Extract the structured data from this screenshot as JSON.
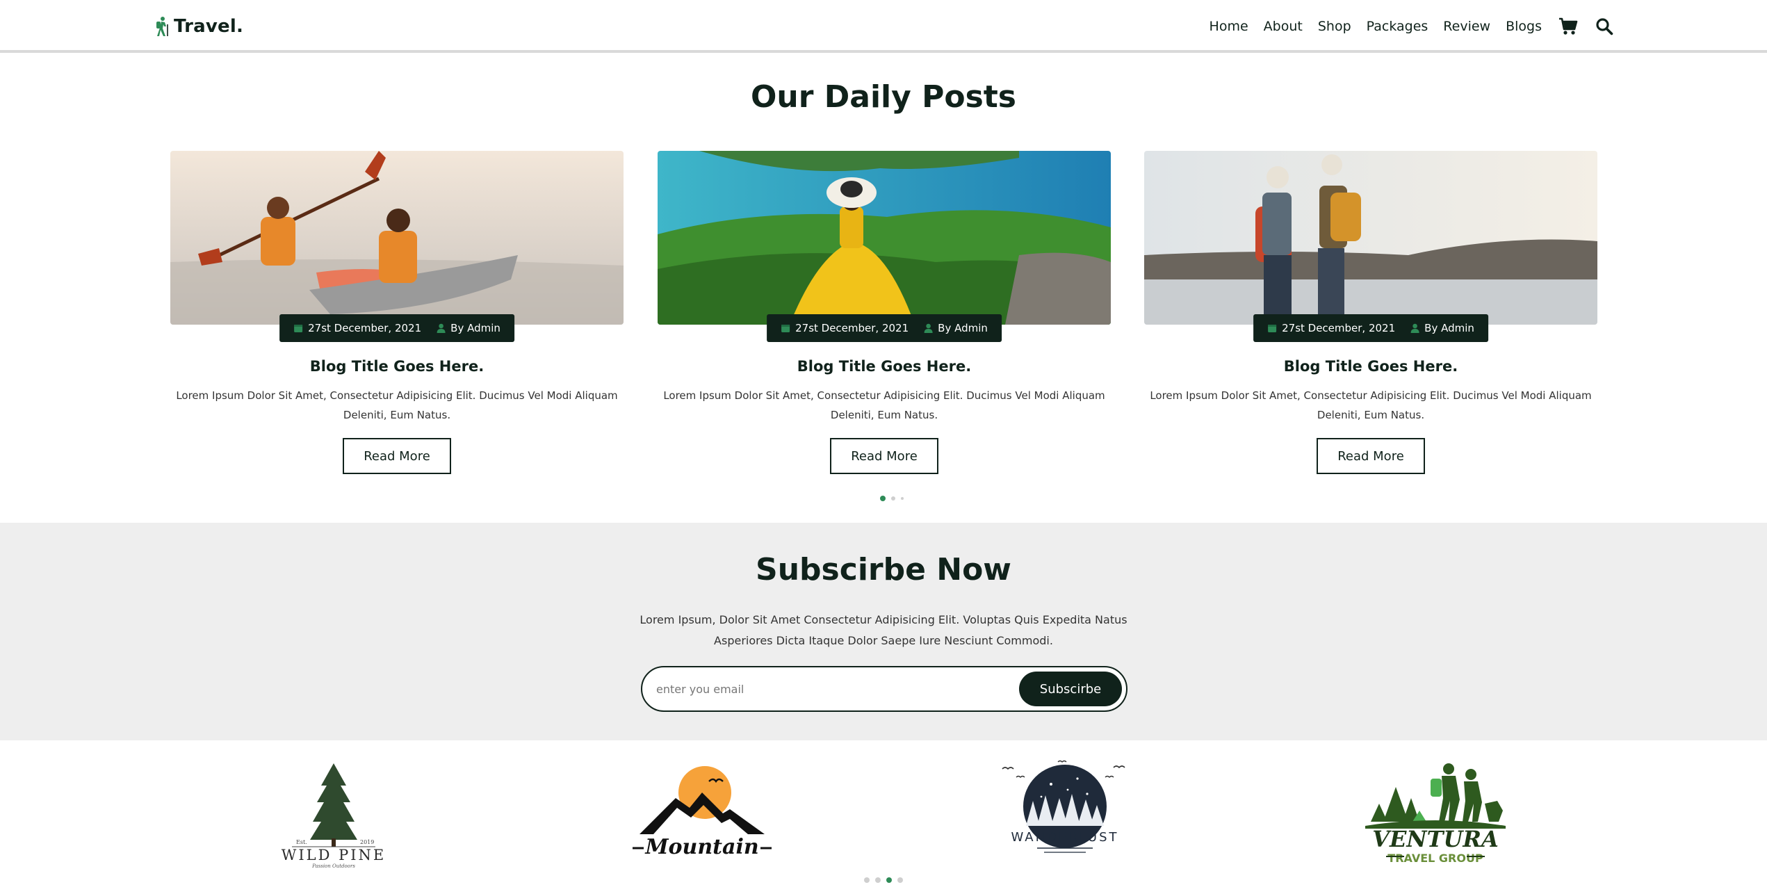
{
  "header": {
    "logo_text": "Travel.",
    "nav": [
      "Home",
      "About",
      "Shop",
      "Packages",
      "Review",
      "Blogs"
    ]
  },
  "posts": {
    "title": "Our Daily Posts",
    "cards": [
      {
        "date": "27st December, 2021",
        "author": "By Admin",
        "title": "Blog Title Goes Here.",
        "text": "Lorem Ipsum Dolor Sit Amet, Consectetur Adipisicing Elit. Ducimus Vel Modi Aliquam Deleniti, Eum Natus.",
        "button": "Read More"
      },
      {
        "date": "27st December, 2021",
        "author": "By Admin",
        "title": "Blog Title Goes Here.",
        "text": "Lorem Ipsum Dolor Sit Amet, Consectetur Adipisicing Elit. Ducimus Vel Modi Aliquam Deleniti, Eum Natus.",
        "button": "Read More"
      },
      {
        "date": "27st December, 2021",
        "author": "By Admin",
        "title": "Blog Title Goes Here.",
        "text": "Lorem Ipsum Dolor Sit Amet, Consectetur Adipisicing Elit. Ducimus Vel Modi Aliquam Deleniti, Eum Natus.",
        "button": "Read More"
      }
    ],
    "pagination_active": 1,
    "pagination_count": 3
  },
  "subscribe": {
    "title": "Subscirbe Now",
    "text_line1": "Lorem Ipsum, Dolor Sit Amet Consectetur Adipisicing Elit. Voluptas Quis Expedita Natus",
    "text_line2": "Asperiores Dicta Itaque Dolor Saepe Iure Nesciunt Commodi.",
    "placeholder": "enter you email",
    "button": "Subscirbe"
  },
  "brands": {
    "wild_pine": {
      "name": "WILD PINE",
      "est": "Est.",
      "year": "2019",
      "tagline": "Passion Outdoors"
    },
    "mountain": {
      "name": "Mountain"
    },
    "wanderlust": {
      "name": "WANDERLUST"
    },
    "ventura": {
      "name": "VENTURA",
      "sub": "TRAVEL GROUP"
    },
    "pagination_active": 3,
    "pagination_count": 4
  },
  "colors": {
    "primary": "#10221b",
    "accent": "#2e8b57",
    "section_bg": "#eeeeee"
  },
  "icons": [
    "hiker-icon",
    "cart-icon",
    "search-icon",
    "calendar-icon",
    "user-icon"
  ]
}
